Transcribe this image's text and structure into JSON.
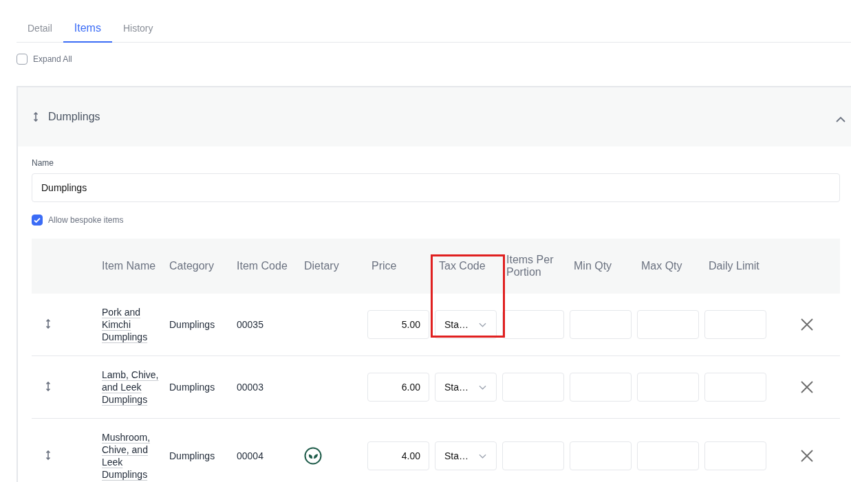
{
  "tabs": [
    {
      "label": "Detail",
      "selected": false
    },
    {
      "label": "Items",
      "selected": true
    },
    {
      "label": "History",
      "selected": false
    }
  ],
  "expand_all": {
    "label": "Expand All",
    "checked": false
  },
  "section": {
    "title": "Dumplings",
    "expanded": true,
    "name_field": {
      "label": "Name",
      "value": "Dumplings"
    },
    "allow_bespoke": {
      "label": "Allow bespoke items",
      "checked": true
    },
    "table": {
      "columns": [
        {
          "label": "Item Name",
          "highlighted": false
        },
        {
          "label": "Category",
          "highlighted": false
        },
        {
          "label": "Item Code",
          "highlighted": false
        },
        {
          "label": "Dietary",
          "highlighted": false
        },
        {
          "label": "Price",
          "highlighted": false
        },
        {
          "label": "Tax Code",
          "highlighted": true
        },
        {
          "label": "Items Per Portion",
          "highlighted": false
        },
        {
          "label": "Min Qty",
          "highlighted": false
        },
        {
          "label": "Max Qty",
          "highlighted": false
        },
        {
          "label": "Daily Limit",
          "highlighted": false
        }
      ],
      "rows": [
        {
          "name": "Pork and Kimchi Dumplings",
          "category": "Dumplings",
          "code": "00035",
          "plant_based": false,
          "price": "5.00",
          "tax_code": "Sta…"
        },
        {
          "name": "Lamb, Chive, and Leek Dumplings",
          "category": "Dumplings",
          "code": "00003",
          "plant_based": false,
          "price": "6.00",
          "tax_code": "Sta…"
        },
        {
          "name": "Mushroom, Chive, and Leek Dumplings",
          "category": "Dumplings",
          "code": "00004",
          "plant_based": true,
          "price": "4.00",
          "tax_code": "Sta…"
        }
      ]
    }
  }
}
